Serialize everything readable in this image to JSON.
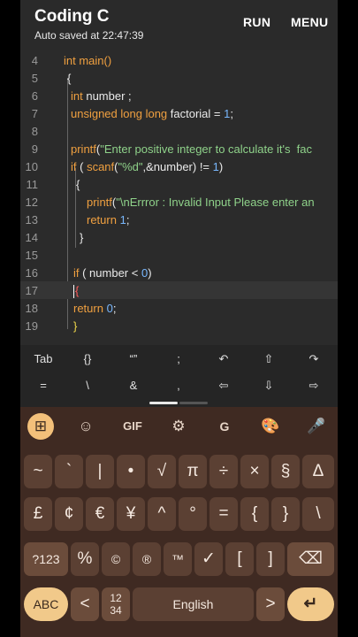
{
  "header": {
    "title": "Coding C",
    "subtitle": "Auto saved at 22:47:39",
    "run_label": "RUN",
    "menu_label": "MENU"
  },
  "editor": {
    "line_numbers": [
      "4",
      "5",
      "6",
      "7",
      "8",
      "9",
      "10",
      "11",
      "12",
      "13",
      "14",
      "15",
      "16",
      "17",
      "18",
      "19"
    ],
    "active_line": "17",
    "code": {
      "l4a": "int",
      "l4b": " main()",
      "l5": "{",
      "l6a": "int",
      "l6b": " number ;",
      "l7a": "unsigned long long",
      "l7b": " factorial = ",
      "l7c": "1",
      "l7d": ";",
      "l9a": "printf",
      "l9b": "(",
      "l9c": "\"Enter positive integer to calculate it's  fac",
      "l10a": "if",
      "l10b": " ( ",
      "l10c": "scanf",
      "l10d": "(",
      "l10e": "\"%d\"",
      "l10f": ",&number) != ",
      "l10g": "1",
      "l10h": ")",
      "l11": "{",
      "l12a": "printf",
      "l12b": "(",
      "l12c": "\"\\n",
      "l12d": "Errror : Invalid Input Please enter an",
      "l13a": "return",
      "l13b": " ",
      "l13c": "1",
      "l13d": ";",
      "l14": "}",
      "l16a": "if",
      "l16b": " ( number < ",
      "l16c": "0",
      "l16d": ")",
      "l17": "{",
      "l18a": "return",
      "l18b": " ",
      "l18c": "0",
      "l18d": ";",
      "l19": "}"
    }
  },
  "helper_keys": {
    "row1": [
      "Tab",
      "{}",
      "“”",
      ";",
      "↶",
      "⇧",
      "↷"
    ],
    "row2": [
      "=",
      "\\",
      "&",
      "‚",
      "⇦",
      "⇩",
      "⇨"
    ]
  },
  "keyboard": {
    "toolbar": [
      "⊞",
      "☺",
      "GIF",
      "⚙",
      "G",
      "🎨",
      "🎤"
    ],
    "row1": [
      "~",
      "`",
      "|",
      "•",
      "√",
      "π",
      "÷",
      "×",
      "§",
      "Δ"
    ],
    "row2": [
      "£",
      "¢",
      "€",
      "¥",
      "^",
      "°",
      "=",
      "{",
      "}",
      "\\"
    ],
    "row3": [
      "?123",
      "%",
      "©",
      "®",
      "™",
      "✓",
      "[",
      "]",
      "⌫"
    ],
    "row4": {
      "abc": "ABC",
      "left": "<",
      "numpad": "12 34",
      "space": "English",
      "right": ">",
      "enter": "↵"
    }
  },
  "colors": {
    "keyword": "#f0a040",
    "string": "#8fd28a",
    "number": "#79b8ff",
    "keyboard_bg": "#3f2a22",
    "key_bg": "#5b4033",
    "accent": "#f1c98a"
  }
}
